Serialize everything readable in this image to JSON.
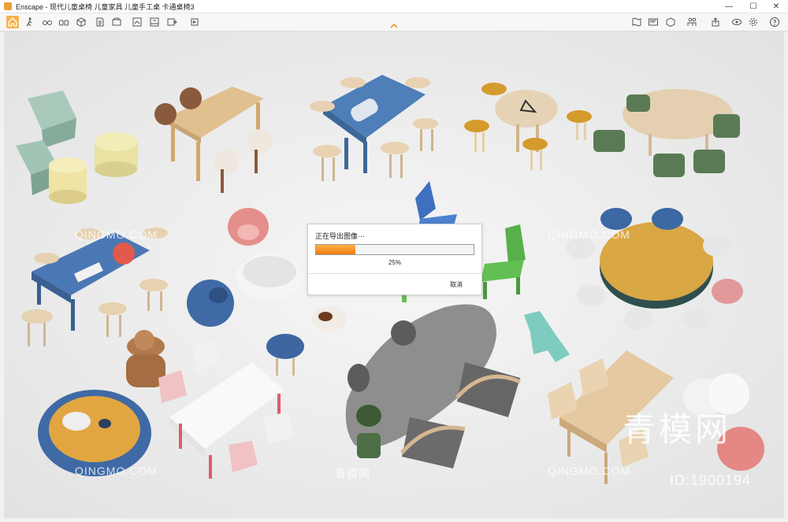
{
  "window": {
    "title": "Enscape - 现代儿童桌椅 儿童家具 儿童手工桌 卡通桌椅3",
    "controls": [
      "—",
      "☐",
      "✕"
    ]
  },
  "toolbar": {
    "left_icons": [
      "home-icon",
      "walk-icon",
      "glasses-icon",
      "binoculars-icon",
      "cube-icon",
      "document-icon",
      "camera-icon",
      "render-icon",
      "scene-icon",
      "export-image-icon",
      "export-video-icon",
      "export-panorama-icon"
    ],
    "right_icons": [
      "map-icon",
      "screen-icon",
      "object-icon",
      "people-icon",
      "upload-icon",
      "vr-icon",
      "settings-icon",
      "help-icon"
    ]
  },
  "dialog": {
    "title": "正在导出图像···",
    "progress": 0.25,
    "percent_label": "25%",
    "cancel_label": "取消"
  },
  "watermarks": {
    "site": "QINGMO.COM",
    "site_cn": "青模网",
    "brand": "青模网",
    "id_label": "ID:1900194"
  },
  "colors": {
    "accent": "#f6b24e",
    "progress_start": "#ffb347",
    "progress_end": "#f07a10"
  }
}
